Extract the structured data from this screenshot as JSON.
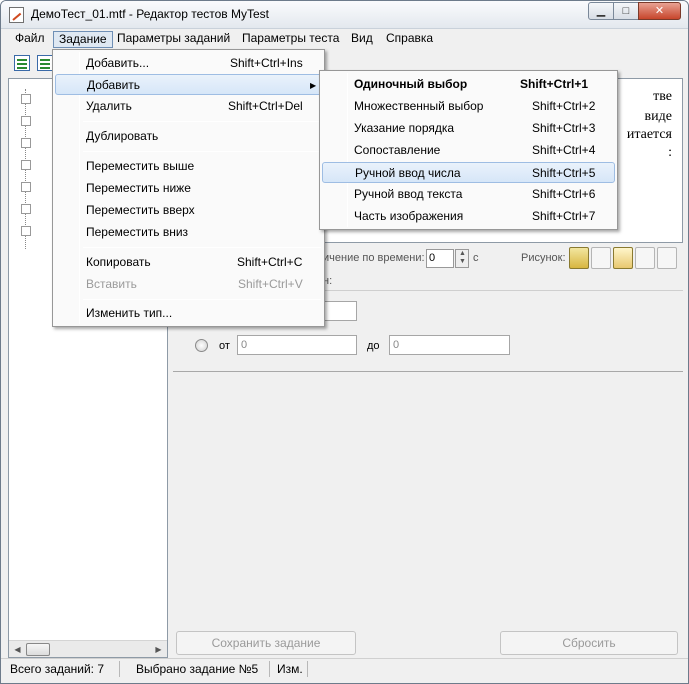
{
  "window": {
    "title": "ДемоТест_01.mtf - Редактор тестов MyTest",
    "minimize": "▁",
    "maximize": "□",
    "close": "✕"
  },
  "menubar": {
    "items": [
      "Файл",
      "Задание",
      "Параметры заданий",
      "Параметры теста",
      "Вид",
      "Справка"
    ]
  },
  "task_menu": {
    "items": [
      {
        "label": "Добавить...",
        "shortcut": "Shift+Ctrl+Ins"
      },
      {
        "label": "Добавить",
        "shortcut": ""
      },
      {
        "label": "Удалить",
        "shortcut": "Shift+Ctrl+Del"
      },
      {
        "label": "Дублировать",
        "shortcut": ""
      },
      {
        "label": "Переместить выше",
        "shortcut": ""
      },
      {
        "label": "Переместить ниже",
        "shortcut": ""
      },
      {
        "label": "Переместить вверх",
        "shortcut": ""
      },
      {
        "label": "Переместить вниз",
        "shortcut": ""
      },
      {
        "label": "Копировать",
        "shortcut": "Shift+Ctrl+C"
      },
      {
        "label": "Вставить",
        "shortcut": "Shift+Ctrl+V"
      },
      {
        "label": "Изменить тип...",
        "shortcut": ""
      }
    ],
    "submenu_arrow": "▶"
  },
  "add_submenu": {
    "items": [
      {
        "label": "Одиночный выбор",
        "shortcut": "Shift+Ctrl+1"
      },
      {
        "label": "Множественный выбор",
        "shortcut": "Shift+Ctrl+2"
      },
      {
        "label": "Указание порядка",
        "shortcut": "Shift+Ctrl+3"
      },
      {
        "label": "Сопоставление",
        "shortcut": "Shift+Ctrl+4"
      },
      {
        "label": "Ручной ввод числа",
        "shortcut": "Shift+Ctrl+5"
      },
      {
        "label": "Ручной ввод текста",
        "shortcut": "Shift+Ctrl+6"
      },
      {
        "label": "Часть изображения",
        "shortcut": "Shift+Ctrl+7"
      }
    ]
  },
  "question": {
    "line1": "тве",
    "line2": "виде",
    "line3": "итается",
    "line4": ":"
  },
  "time_row": {
    "label": "ичение по времени:",
    "value": "0",
    "unit": "с",
    "picture_label": "Рисунок:"
  },
  "answers": {
    "label": "н:",
    "from_label": "от",
    "from_value": "0",
    "to_label": "до",
    "to_value": "0"
  },
  "buttons": {
    "save": "Сохранить задание",
    "reset": "Сбросить"
  },
  "status": {
    "total": "Всего заданий: 7",
    "selected": "Выбрано задание №5",
    "modified": "Изм."
  },
  "scroll": {
    "left_arrow": "◀",
    "right_arrow": "▶"
  },
  "spin": {
    "up": "▲",
    "down": "▼"
  }
}
